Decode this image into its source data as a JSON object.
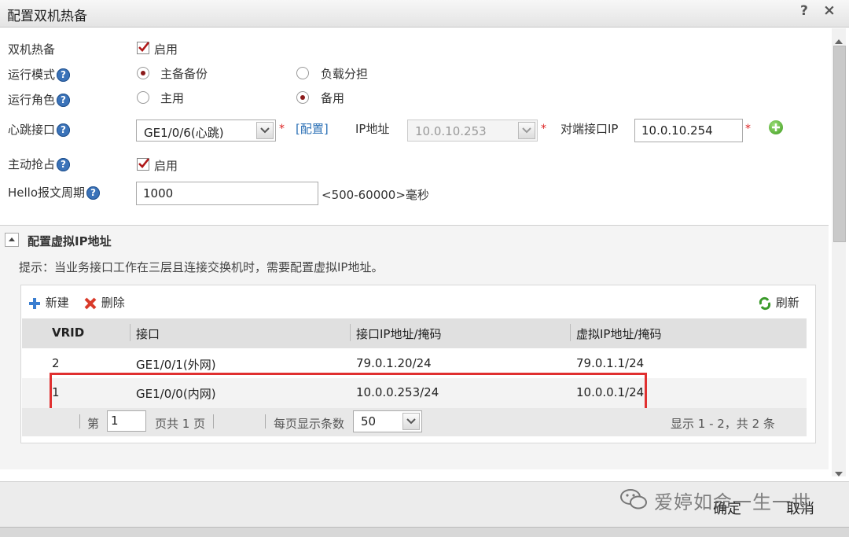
{
  "window": {
    "title": "配置双机热备",
    "help_label": "?",
    "close_label": "×"
  },
  "form": {
    "hot_standby": {
      "label": "双机热备",
      "checkbox_label": "启用"
    },
    "run_mode": {
      "label": "运行模式",
      "options": [
        "主备备份",
        "负载分担"
      ],
      "selected": "主备备份"
    },
    "run_role": {
      "label": "运行角色",
      "options": [
        "主用",
        "备用"
      ],
      "selected": "备用"
    },
    "heartbeat": {
      "label": "心跳接口",
      "interface_value": "GE1/0/6(心跳)",
      "config_link": "[配置]",
      "ip_label": "IP地址",
      "ip_value": "10.0.10.253",
      "peer_label": "对端接口IP",
      "peer_value": "10.0.10.254",
      "required_mark": "*"
    },
    "preempt": {
      "label": "主动抢占",
      "checkbox_label": "启用"
    },
    "hello": {
      "label": "Hello报文周期",
      "value": "1000",
      "hint": "<500-60000>毫秒"
    },
    "help_icon_text": "?"
  },
  "vip_section": {
    "title": "配置虚拟IP地址",
    "hint": "提示：当业务接口工作在三层且连接交换机时，需要配置虚拟IP地址。",
    "toolbar": {
      "new_label": "新建",
      "delete_label": "删除",
      "refresh_label": "刷新"
    },
    "columns": [
      "VRID",
      "接口",
      "接口IP地址/掩码",
      "虚拟IP地址/掩码"
    ],
    "rows": [
      [
        "2",
        "GE1/0/1(外网)",
        "79.0.1.20/24",
        "79.0.1.1/24"
      ],
      [
        "1",
        "GE1/0/0(内网)",
        "10.0.0.253/24",
        "10.0.0.1/24"
      ]
    ],
    "pager": {
      "page_prefix": "第",
      "page_value": "1",
      "page_suffix": "页共 1 页",
      "per_page_label": "每页显示条数",
      "per_page_value": "50",
      "summary": "显示 1 - 2，共 2 条"
    }
  },
  "footer": {
    "ok_label": "确定",
    "cancel_label": "取消",
    "watermark": "爱婷如命一生一世"
  },
  "colors": {
    "highlight_border": "#e03030",
    "help_blue": "#3b73b9",
    "radio_dot": "#8b1a1a"
  }
}
